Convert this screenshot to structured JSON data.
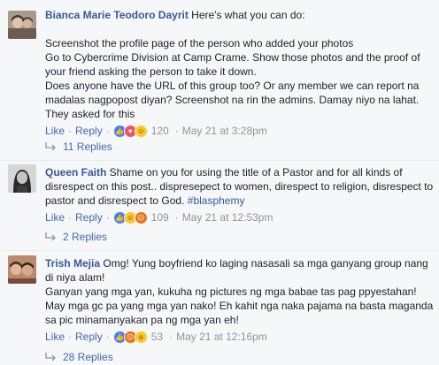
{
  "comments": [
    {
      "author": "Bianca Marie Teodoro Dayrit",
      "first_line": " Here's what you can do:",
      "body": "Screenshot the profile page of the person who added your photos\nGo to Cybercrime Division at Camp Crame. Show those photos and the proof of your friend asking the person to take it down.\nDoes anyone have the URL of this group too? Or any member we can report na madalas nagpopost diyan? Screenshot na rin the admins. Damay niyo na lahat. They asked for this",
      "like_label": "Like",
      "reply_label": "Reply",
      "reaction_icons": [
        "like-icon",
        "love-icon",
        "haha-icon"
      ],
      "reaction_count": "120",
      "date": "May 21 at 3:28pm",
      "replies_label": "11 Replies",
      "avatar_colors": [
        "#a89a8a",
        "#3c3a38"
      ]
    },
    {
      "author": "Queen Faith",
      "first_line": " Shame on you for using the title of a Pastor and for all kinds of disrespect on this post.. dispresepect to women, direspect to religion, disrespect to pastor and disrespect to God. ",
      "hashtag": "#blasphemy",
      "like_label": "Like",
      "reply_label": "Reply",
      "reaction_icons": [
        "like-icon",
        "haha-icon",
        "angry-icon"
      ],
      "reaction_count": "109",
      "date": "May 21 at 12:53pm",
      "replies_label": "2 Replies",
      "avatar_colors": [
        "#d6d6d6",
        "#2a2a2a"
      ]
    },
    {
      "author": "Trish Mejia",
      "first_line": " Omg! Yung boyfriend ko laging nasasali sa mga ganyang group nang di niya alam!",
      "body": "Ganyan yang mga yan, kukuha ng pictures ng mga babae tas pag ppyestahan! May mga gc pa yang mga yan nako! Eh kahit nga naka pajama na basta maganda sa pic minamanyakan pa ng mga yan eh!",
      "like_label": "Like",
      "reply_label": "Reply",
      "reaction_icons": [
        "like-icon",
        "angry-icon",
        "wow-icon"
      ],
      "reaction_count": "53",
      "date": "May 21 at 12:16pm",
      "replies_label": "28 Replies",
      "avatar_colors": [
        "#b98a6e",
        "#3b2a22"
      ]
    }
  ],
  "separator": "·"
}
